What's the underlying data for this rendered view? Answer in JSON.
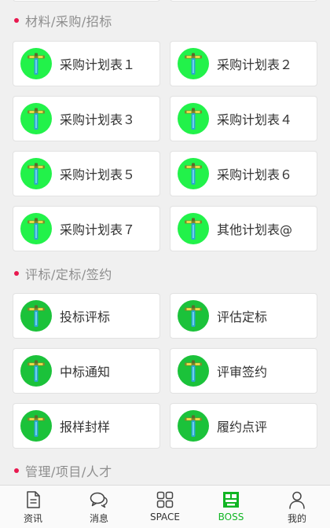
{
  "sections": [
    {
      "title": "材料/采购/招标",
      "items": [
        {
          "label": "采购计划表１"
        },
        {
          "label": "采购计划表２"
        },
        {
          "label": "采购计划表３"
        },
        {
          "label": "采购计划表４"
        },
        {
          "label": "采购计划表５"
        },
        {
          "label": "采购计划表６"
        },
        {
          "label": "采购计划表７"
        },
        {
          "label": "其他计划表@"
        }
      ]
    },
    {
      "title": "评标/定标/签约",
      "items": [
        {
          "label": "投标评标"
        },
        {
          "label": "评估定标"
        },
        {
          "label": "中标通知"
        },
        {
          "label": "评审签约"
        },
        {
          "label": "报样封样"
        },
        {
          "label": "履约点评"
        }
      ]
    },
    {
      "title": "管理/项目/人才",
      "items": []
    }
  ],
  "tabs": [
    {
      "label": "资讯",
      "icon": "document-icon"
    },
    {
      "label": "消息",
      "icon": "chat-bubble-icon"
    },
    {
      "label": "SPACE",
      "icon": "grid-icon"
    },
    {
      "label": "BOSS",
      "icon": "boss-app-icon",
      "active": true
    },
    {
      "label": "我的",
      "icon": "person-icon"
    }
  ],
  "colors": {
    "accent_dot": "#e8194f",
    "active_tab": "#10b523",
    "icon_bright_green": "#22f24a",
    "icon_dark_green": "#1bc23a"
  }
}
